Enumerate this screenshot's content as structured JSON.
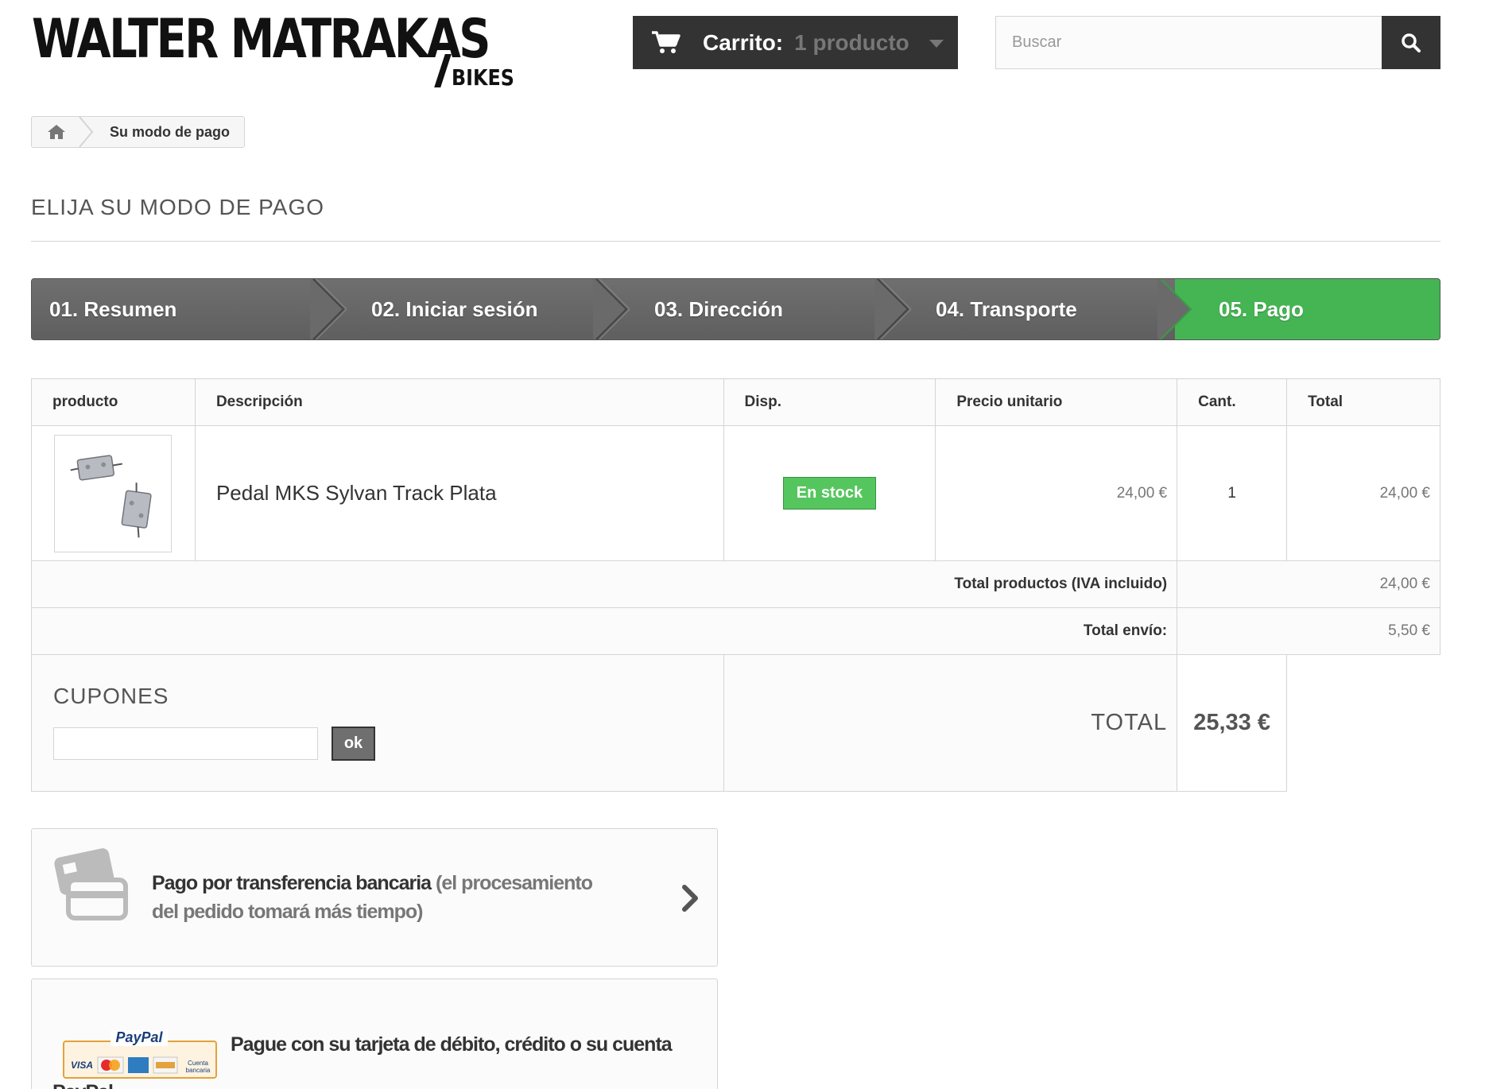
{
  "brand": {
    "name": "WALTER MATRAKAS",
    "sub": "BIKES"
  },
  "cart": {
    "label": "Carrito:",
    "count": "1 producto"
  },
  "search": {
    "placeholder": "Buscar"
  },
  "breadcrumb": {
    "current": "Su modo de pago"
  },
  "page_title": "ELIJA SU MODO DE PAGO",
  "steps": [
    {
      "label": "01. Resumen",
      "state": "done"
    },
    {
      "label": "02. Iniciar sesión",
      "state": "done"
    },
    {
      "label": "03. Dirección",
      "state": "done"
    },
    {
      "label": "04. Transporte",
      "state": "done"
    },
    {
      "label": "05. Pago",
      "state": "active"
    }
  ],
  "table": {
    "headers": [
      "producto",
      "Descripción",
      "Disp.",
      "Precio unitario",
      "Cant.",
      "Total"
    ],
    "rows": [
      {
        "image": "pedal-image",
        "description": "Pedal MKS Sylvan Track Plata",
        "availability": "En stock",
        "unit_price": "24,00 €",
        "qty": "1",
        "total": "24,00 €"
      }
    ],
    "total_products_label": "Total productos (IVA incluido)",
    "total_products_value": "24,00 €",
    "shipping_label": "Total envío:",
    "shipping_value": "5,50 €",
    "coupons_title": "CUPONES",
    "coupon_button": "ok",
    "total_label": "TOTAL",
    "total_value": "25,33 €"
  },
  "payments": {
    "bank": {
      "title": "Pago por transferencia bancaria",
      "note": "(el procesamiento del pedido tomará más tiempo)"
    },
    "paypal": {
      "text": "Pague con su tarjeta de débito, crédito o su cuenta",
      "text2": "PayPal",
      "logo_text": "PayPal",
      "card_labels": [
        "VISA",
        "Cuenta bancaria"
      ]
    }
  },
  "colors": {
    "dark": "#333333",
    "step_gray": "#666666",
    "step_active": "#45b553",
    "stock_green": "#55c65e",
    "border": "#d6d4d4"
  }
}
